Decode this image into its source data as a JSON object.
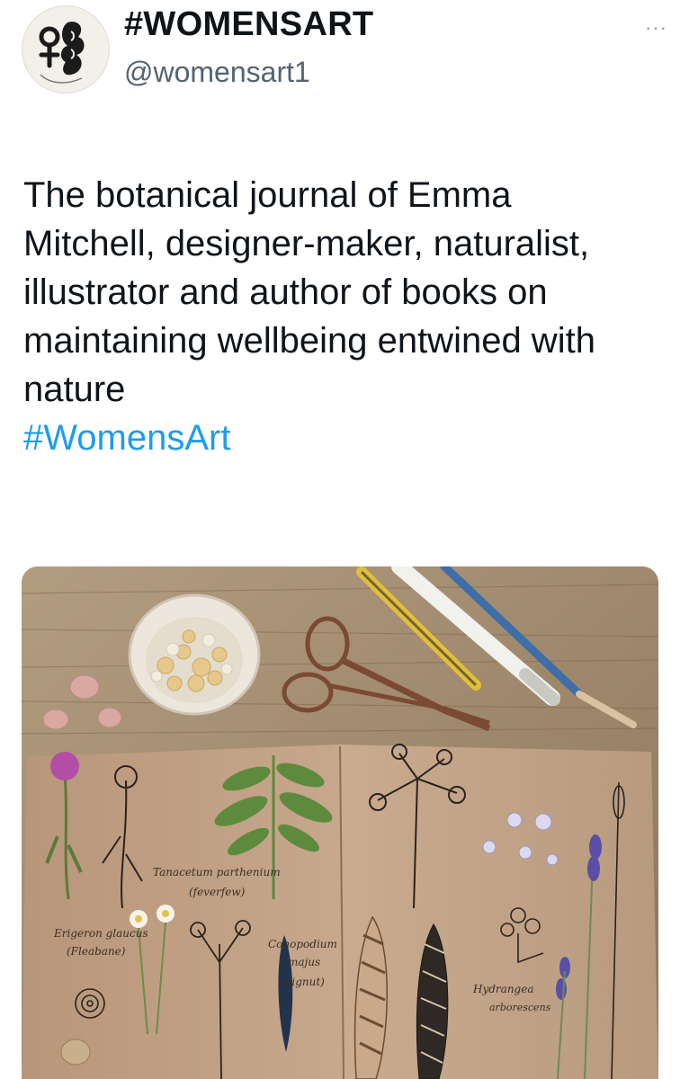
{
  "account": {
    "display_name": "#WOMENSART",
    "handle": "@womensart1",
    "avatar_icon": "womensart-logo-icon"
  },
  "menu": {
    "more_label": "···"
  },
  "tweet": {
    "text": "The botanical journal of Emma Mitchell, designer-maker, naturalist, illustrator and author of books on maintaining wellbeing entwined with nature",
    "hashtag": "#WomensArt"
  },
  "media": {
    "labels": {
      "tanacetum": "Tanacetum parthenium",
      "feverfew": "(feverfew)",
      "erigeron": "Erigeron glaucus",
      "fleabane": "(Fleabane)",
      "conopodium": "Conopodium",
      "majus": "majus",
      "pignut": "(pignut)",
      "hydrangea": "Hydrangea",
      "arborescens": "arborescens"
    }
  },
  "colors": {
    "hashtag": "#1d9bf0",
    "handle": "#536471",
    "text": "#0f1419"
  }
}
